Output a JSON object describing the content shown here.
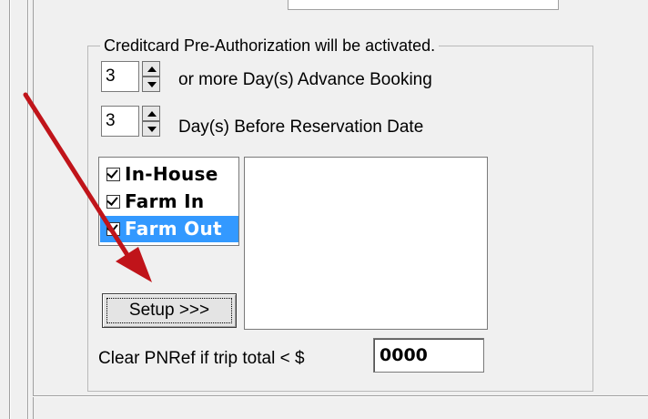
{
  "group": {
    "title": "Creditcard Pre-Authorization will be activated."
  },
  "advance_booking": {
    "value": "3",
    "label": "or more Day(s) Advance Booking"
  },
  "before_reservation": {
    "value": "3",
    "label": "Day(s) Before Reservation Date"
  },
  "checklist": {
    "items": [
      {
        "label": "In-House",
        "checked": true,
        "selected": false
      },
      {
        "label": "Farm In",
        "checked": true,
        "selected": false
      },
      {
        "label": "Farm Out",
        "checked": true,
        "selected": true
      }
    ]
  },
  "setup_button": {
    "label": "Setup >>>"
  },
  "clear_pnref": {
    "label": "Clear PNRef if trip total < $",
    "value": "0000"
  },
  "colors": {
    "selection": "#3399ff",
    "arrow": "#c0141a",
    "panel_bg": "#f0f0f0"
  },
  "icons": {
    "spin_up": "triangle-up-icon",
    "spin_down": "triangle-down-icon",
    "annotation": "red-arrow-icon"
  }
}
